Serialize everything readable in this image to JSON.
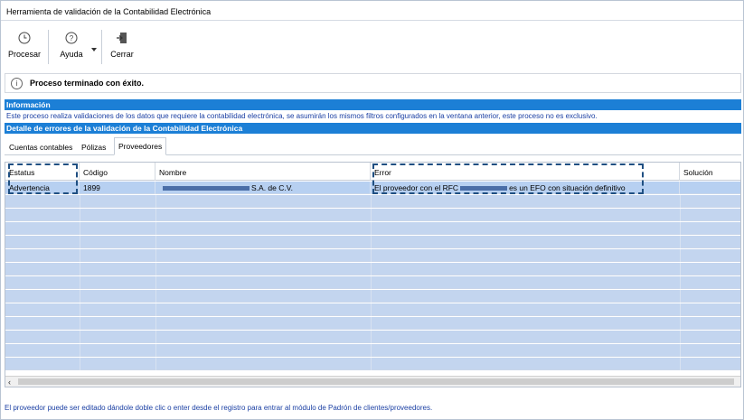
{
  "window": {
    "title": "Herramienta de validación de la Contabilidad Electrónica"
  },
  "toolbar": {
    "buttons": [
      {
        "label": "Procesar",
        "icon": "clock-icon"
      },
      {
        "label": "Ayuda",
        "icon": "help-icon"
      },
      {
        "label": "Cerrar",
        "icon": "exit-door-icon"
      }
    ]
  },
  "status": {
    "message": "Proceso terminado con éxito."
  },
  "info_section": {
    "title": "Información",
    "description": "Este proceso realiza validaciones de los datos que requiere la contabilidad electrónica, se asumirán los mismos filtros configurados en la ventana anterior, este proceso no es exclusivo."
  },
  "errors_section": {
    "title": "Detalle de errores de la validación de la Contabilidad Electrónica"
  },
  "tabs": [
    {
      "label": "Cuentas contables",
      "active": false
    },
    {
      "label": "Pólizas",
      "active": false
    },
    {
      "label": "Proveedores",
      "active": true
    }
  ],
  "grid": {
    "columns": [
      "Estatus",
      "Código",
      "Nombre",
      "Error",
      "Solución"
    ],
    "rows": [
      {
        "estatus": "Advertencia",
        "codigo": "1899",
        "nombre_suffix": "S.A. de C.V.",
        "error_prefix": "El proveedor con el RFC",
        "error_suffix": "es un EFO con situación definitivo",
        "solucion": ""
      }
    ]
  },
  "footer": {
    "hint": "El proveedor puede ser editado dándole doble clic o enter desde el registro para entrar al módulo de Padrón de clientes/proveedores."
  },
  "colors": {
    "section_header": "#1c7fd6",
    "row_selected": "#b7d0f1",
    "annotation_dash": "#1f4f82"
  }
}
